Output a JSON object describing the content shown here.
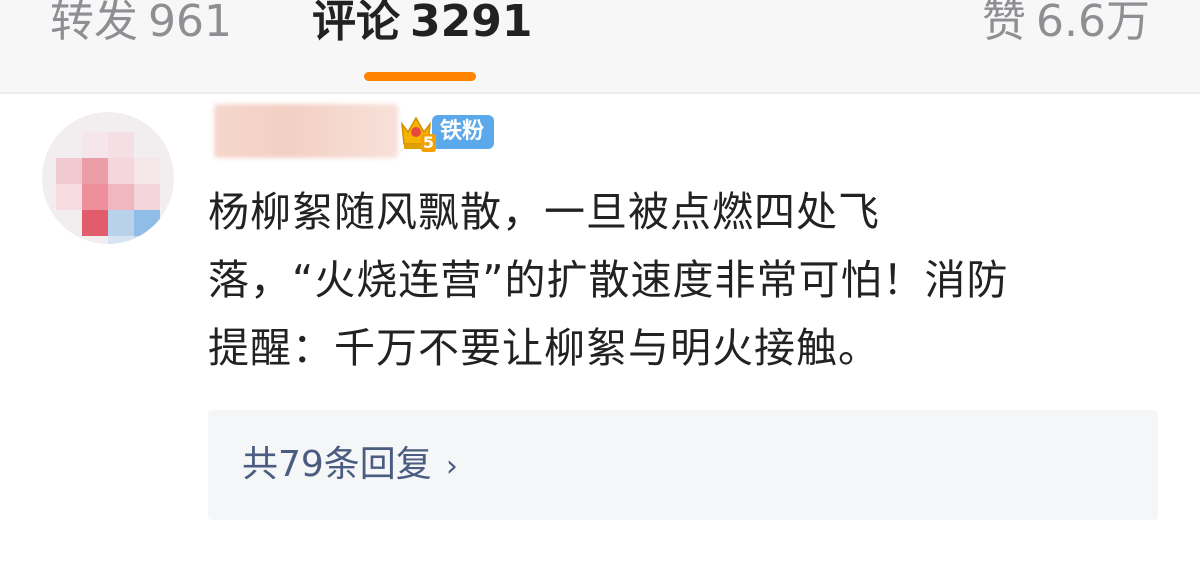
{
  "tabs": {
    "repost": {
      "label": "转发",
      "count": "961"
    },
    "comments": {
      "label": "评论",
      "count": "3291"
    },
    "likes": {
      "label": "赞",
      "count": "6.6万"
    }
  },
  "colors": {
    "accent": "#ff8200",
    "fan_badge": "#5ba8ea",
    "link": "#4a5c80"
  },
  "comment": {
    "fan_badge_label": "铁粉",
    "fan_level": "5",
    "text_lines": [
      "杨柳絮随风飘散，一旦被点燃四处飞",
      "落，“火烧连营”的扩散速度非常可怕！消防",
      "提醒：千万不要让柳絮与明火接触。"
    ],
    "replies_label": "共79条回复",
    "replies_chevron": "›"
  }
}
